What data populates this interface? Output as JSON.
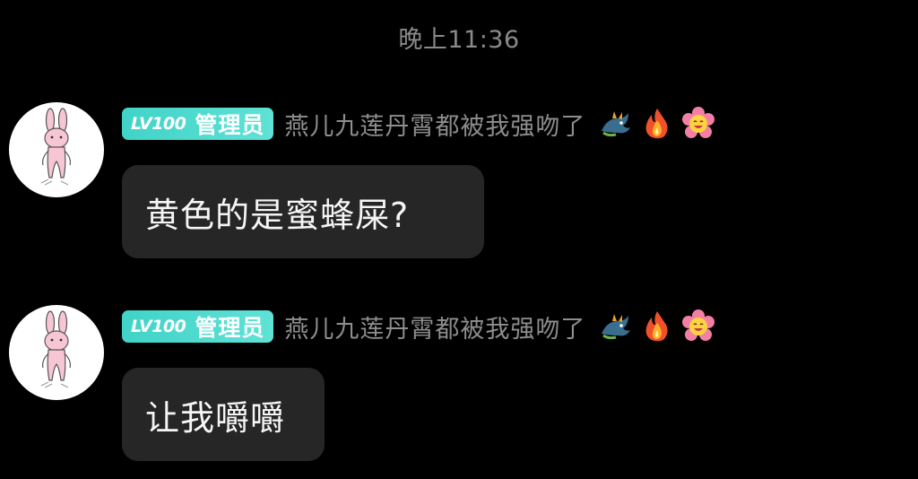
{
  "header": {
    "timestamp": "晚上11:36"
  },
  "messages": [
    {
      "avatar_icon": "pink-rabbit-avatar",
      "badge": {
        "level": "LV100",
        "role": "管理员",
        "color": "#4fd8cc"
      },
      "username": "燕儿九莲丹霄都被我强吻了",
      "decorations": [
        "dragon-icon",
        "fire-icon",
        "smiling-flower-icon"
      ],
      "text": "黄色的是蜜蜂屎?"
    },
    {
      "avatar_icon": "pink-rabbit-avatar",
      "badge": {
        "level": "LV100",
        "role": "管理员",
        "color": "#4fd8cc"
      },
      "username": "燕儿九莲丹霄都被我强吻了",
      "decorations": [
        "dragon-icon",
        "fire-icon",
        "smiling-flower-icon"
      ],
      "text": "让我嚼嚼"
    }
  ],
  "colors": {
    "background": "#000000",
    "bubble": "#262626",
    "badge": "#4fd8cc",
    "username": "#8e8e8e",
    "timestamp": "#8a8a8a"
  }
}
